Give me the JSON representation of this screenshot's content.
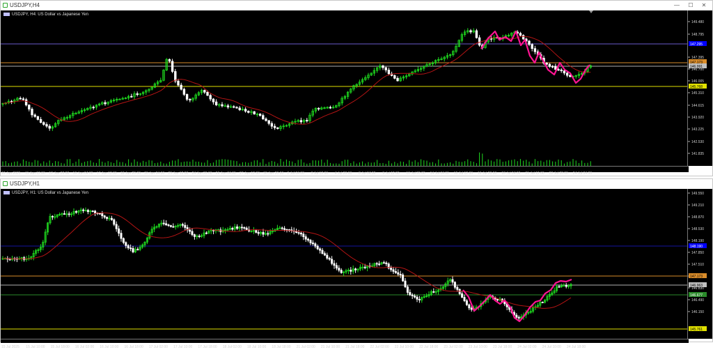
{
  "colors": {
    "bull": "#1fdc1f",
    "bear": "#ffffff",
    "ma": "#b41414",
    "pattern": "#ff1493",
    "hline_blue": "#6a5acd",
    "hline_orange": "#d98c2a",
    "hline_yellow": "#e0e000",
    "hline_gray": "#b0b0b0",
    "volume": "#1fdc1f"
  },
  "windows": [
    {
      "id": "h4",
      "title": "USDJPY,H4",
      "symbol_label": "USDJPY, H4:  US Dollar vs Japanese Yen",
      "controls": [
        "—",
        "☐",
        "✕"
      ],
      "price_ticks": [
        "149.480",
        "148.795",
        "147.395",
        "146.700",
        "146.005",
        "145.310",
        "144.615",
        "143.920",
        "143.225",
        "142.530",
        "141.835"
      ],
      "price_tags": [
        {
          "label": "147.295",
          "color": "#0000ff",
          "text_color": "#ffffff"
        },
        {
          "label": "147.173",
          "color": "#d98c2a",
          "text_color": "#000000"
        },
        {
          "label": "146.991",
          "color": "#c0c0c0",
          "text_color": "#000000"
        },
        {
          "label": "145.768",
          "color": "#e0e000",
          "text_color": "#000000"
        }
      ],
      "time_labels": [
        "10 Jun 2025",
        "11 Jun 12:00",
        "12 Jun 20:00",
        "16 Jun 04:00",
        "17 Jun 12:00",
        "18 Jun 20:00",
        "20 Jun 04:00",
        "23 Jun 12:00",
        "24 Jun 20:00",
        "26 Jun 04:00",
        "27 Jun 12:00",
        "30 Jun 20:00",
        "2 Jul 04:00",
        "3 Jul 12:00",
        "4 Jul 20:00",
        "8 Jul 04:00",
        "9 Jul 12:00",
        "10 Jul 20:00",
        "14 Jul 04:00",
        "15 Jul 12:00",
        "16 Jul 20:00",
        "18 Jul 04:00",
        "21 Jul 12:00",
        "22 Jul 20:00",
        "24 Jul 04:00"
      ]
    },
    {
      "id": "h1",
      "title": "USDJPY,H1",
      "symbol_label": "USDJPY, H1:  US Dollar vs Japanese Yen",
      "controls": [],
      "price_ticks": [
        "149.550",
        "149.210",
        "148.870",
        "148.530",
        "148.190",
        "147.850",
        "147.510",
        "147.170",
        "146.830",
        "146.490",
        "146.150"
      ],
      "price_tags": [
        {
          "label": "148.190",
          "color": "#0000ff",
          "text_color": "#ffffff"
        },
        {
          "label": "147.173",
          "color": "#d98c2a",
          "text_color": "#000000"
        },
        {
          "label": "146.963",
          "color": "#c0c0c0",
          "text_color": "#000000"
        },
        {
          "label": "146.677",
          "color": "#2a8a2a",
          "text_color": "#ffffff"
        },
        {
          "label": "145.761",
          "color": "#e0e000",
          "text_color": "#000000"
        }
      ],
      "time_labels": [
        "15 Jul 2025",
        "15 Jul 10:00",
        "15 Jul 18:00",
        "16 Jul 02:00",
        "16 Jul 10:00",
        "16 Jul 18:00",
        "17 Jul 02:00",
        "17 Jul 10:00",
        "17 Jul 18:00",
        "18 Jul 02:00",
        "18 Jul 10:00",
        "18 Jul 18:00",
        "21 Jul 02:00",
        "21 Jul 10:00",
        "21 Jul 18:00",
        "22 Jul 02:00",
        "22 Jul 10:00",
        "22 Jul 18:00",
        "23 Jul 02:00",
        "23 Jul 10:00",
        "23 Jul 18:00",
        "24 Jul 02:00",
        "24 Jul 10:00",
        "24 Jul 18:00"
      ]
    }
  ]
}
